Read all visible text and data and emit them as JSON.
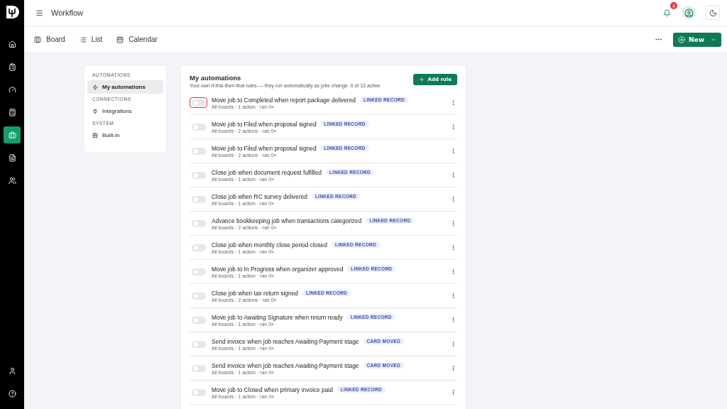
{
  "rail": {
    "items": [
      {
        "kind": "home",
        "selected": false
      },
      {
        "kind": "clipboard",
        "selected": false
      },
      {
        "kind": "gauge",
        "selected": false
      },
      {
        "kind": "calculator",
        "selected": false
      },
      {
        "kind": "briefcase",
        "selected": true
      },
      {
        "kind": "file",
        "selected": false
      },
      {
        "kind": "users",
        "selected": false
      }
    ],
    "bottom": [
      {
        "kind": "user"
      },
      {
        "kind": "help"
      }
    ]
  },
  "header": {
    "title": "Workflow",
    "notifications": "4"
  },
  "views": [
    {
      "label": "Board",
      "kind": "board"
    },
    {
      "label": "List",
      "kind": "list"
    },
    {
      "label": "Calendar",
      "kind": "calendar"
    }
  ],
  "new_button": "New",
  "settings_nav": [
    {
      "heading": "AUTOMATIONS",
      "items": [
        {
          "label": "My automations",
          "kind": "zap",
          "selected": true
        }
      ]
    },
    {
      "heading": "CONNECTIONS",
      "items": [
        {
          "label": "Integrations",
          "kind": "plug",
          "selected": false
        }
      ]
    },
    {
      "heading": "SYSTEM",
      "items": [
        {
          "label": "Built-in",
          "kind": "train",
          "selected": false
        }
      ]
    }
  ],
  "panel": {
    "title": "My automations",
    "subtitle": "Your own if-this-then-that rules — they run automatically as jobs change. 0 of 13 active.",
    "add_button": "Add rule",
    "rules": [
      {
        "name": "Move job to Completed when report package delivered",
        "tag": "LINKED RECORD",
        "meta": "All boards · 1 action · ran 0×",
        "on": false,
        "focused": true
      },
      {
        "name": "Move job to Filed when proposal signed",
        "tag": "LINKED RECORD",
        "meta": "All boards · 2 actions · ran 0×",
        "on": false,
        "focused": false
      },
      {
        "name": "Move job to Filed when proposal signed",
        "tag": "LINKED RECORD",
        "meta": "All boards · 2 actions · ran 0×",
        "on": false,
        "focused": false
      },
      {
        "name": "Close job when document request fulfilled",
        "tag": "LINKED RECORD",
        "meta": "All boards · 1 action · ran 0×",
        "on": false,
        "focused": false
      },
      {
        "name": "Close job when RC survey delivered",
        "tag": "LINKED RECORD",
        "meta": "All boards · 1 action · ran 0×",
        "on": false,
        "focused": false
      },
      {
        "name": "Advance bookkeeping job when transactions categorized",
        "tag": "LINKED RECORD",
        "meta": "All boards · 2 actions · ran 0×",
        "on": false,
        "focused": false
      },
      {
        "name": "Close job when monthly close period closed",
        "tag": "LINKED RECORD",
        "meta": "All boards · 1 action · ran 0×",
        "on": false,
        "focused": false
      },
      {
        "name": "Move job to In Progress when organizer approved",
        "tag": "LINKED RECORD",
        "meta": "All boards · 1 action · ran 0×",
        "on": false,
        "focused": false
      },
      {
        "name": "Close job when tax return signed",
        "tag": "LINKED RECORD",
        "meta": "All boards · 2 actions · ran 0×",
        "on": false,
        "focused": false
      },
      {
        "name": "Move job to Awaiting Signature when return ready",
        "tag": "LINKED RECORD",
        "meta": "All boards · 1 action · ran 0×",
        "on": false,
        "focused": false
      },
      {
        "name": "Send invoice when job reaches Awaiting Payment stage",
        "tag": "CARD MOVED",
        "meta": "All boards · 1 action · ran 0×",
        "on": false,
        "focused": false
      },
      {
        "name": "Send invoice when job reaches Awaiting Payment stage",
        "tag": "CARD MOVED",
        "meta": "All boards · 1 action · ran 0×",
        "on": false,
        "focused": false
      },
      {
        "name": "Move job to Closed when primary invoice paid",
        "tag": "LINKED RECORD",
        "meta": "All boards · 1 action · ran 0×",
        "on": false,
        "focused": false
      }
    ]
  }
}
